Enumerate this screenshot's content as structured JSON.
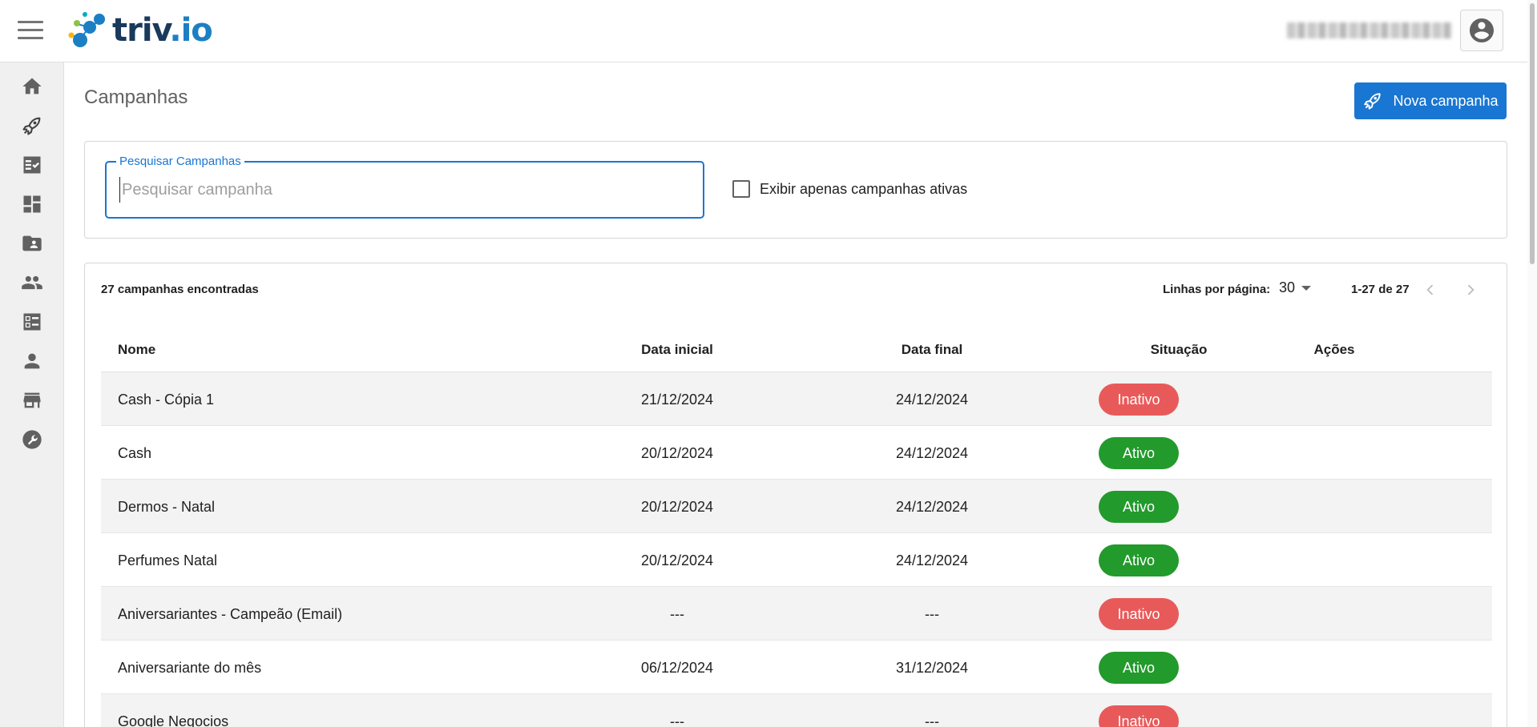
{
  "app": {
    "logo_main": "triv",
    "logo_suffix": ".io"
  },
  "sidebar": {
    "items": [
      {
        "name": "home"
      },
      {
        "name": "campaigns"
      },
      {
        "name": "tasks"
      },
      {
        "name": "dashboard"
      },
      {
        "name": "contacts-folder"
      },
      {
        "name": "groups"
      },
      {
        "name": "lists"
      },
      {
        "name": "users"
      },
      {
        "name": "stores"
      },
      {
        "name": "tools"
      }
    ]
  },
  "page": {
    "title": "Campanhas",
    "new_button_label": "Nova campanha"
  },
  "filters": {
    "search_legend": "Pesquisar Campanhas",
    "search_placeholder": "Pesquisar campanha",
    "search_value": "",
    "active_only_label": "Exibir apenas campanhas ativas",
    "active_only_checked": false
  },
  "table": {
    "count_text": "27 campanhas encontradas",
    "rows_per_page_label": "Linhas por página:",
    "rows_per_page_value": "30",
    "range_text": "1-27 de 27",
    "columns": [
      "Nome",
      "Data inicial",
      "Data final",
      "Situação",
      "Ações"
    ],
    "rows": [
      {
        "nome": "Cash - Cópia 1",
        "data_inicial": "21/12/2024",
        "data_final": "24/12/2024",
        "situacao": "Inativo"
      },
      {
        "nome": "Cash",
        "data_inicial": "20/12/2024",
        "data_final": "24/12/2024",
        "situacao": "Ativo"
      },
      {
        "nome": "Dermos - Natal",
        "data_inicial": "20/12/2024",
        "data_final": "24/12/2024",
        "situacao": "Ativo"
      },
      {
        "nome": "Perfumes Natal",
        "data_inicial": "20/12/2024",
        "data_final": "24/12/2024",
        "situacao": "Ativo"
      },
      {
        "nome": "Aniversariantes - Campeão (Email)",
        "data_inicial": "---",
        "data_final": "---",
        "situacao": "Inativo"
      },
      {
        "nome": "Aniversariante do mês",
        "data_inicial": "06/12/2024",
        "data_final": "31/12/2024",
        "situacao": "Ativo"
      },
      {
        "nome": "Google Negocios",
        "data_inicial": "---",
        "data_final": "---",
        "situacao": "Inativo"
      }
    ]
  },
  "colors": {
    "primary": "#1976d2",
    "active": "#229a2c",
    "inactive": "#e85a5a"
  }
}
